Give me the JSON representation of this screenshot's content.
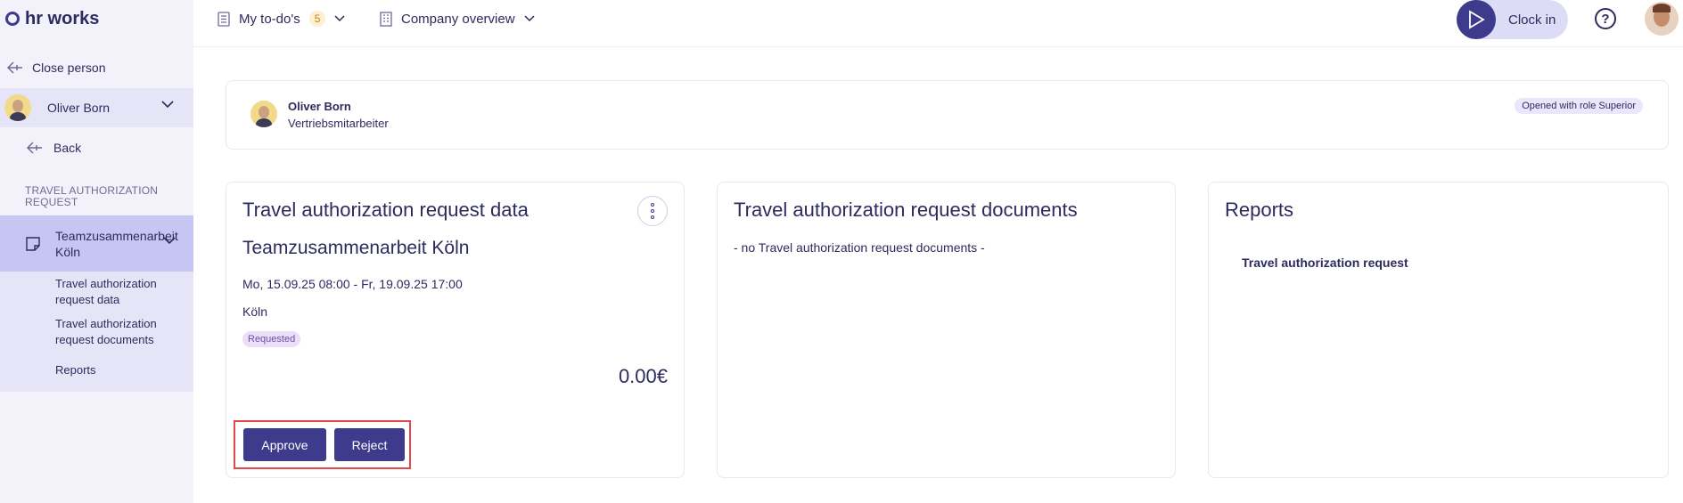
{
  "brand": {
    "name": "hr works"
  },
  "topbar": {
    "todos_label": "My to-do's",
    "todos_count": "5",
    "company_label": "Company overview",
    "clock_label": "Clock in",
    "help_glyph": "?"
  },
  "sidebar": {
    "close_person": "Close person",
    "person_name": "Oliver Born",
    "back": "Back",
    "section_label": "TRAVEL AUTHORIZATION REQUEST",
    "request_title": "Teamzusammenarbeit Köln",
    "sub_links": [
      "Travel authorization request data",
      "Travel authorization request documents",
      "Reports"
    ]
  },
  "person_card": {
    "name": "Oliver Born",
    "role": "Vertriebsmitarbeiter",
    "badge": "Opened with role Superior"
  },
  "data_card": {
    "title": "Travel authorization request data",
    "trip_name": "Teamzusammenarbeit Köln",
    "dates": "Mo, 15.09.25 08:00 - Fr, 19.09.25 17:00",
    "city": "Köln",
    "status": "Requested",
    "amount": "0.00€",
    "approve": "Approve",
    "reject": "Reject"
  },
  "docs_card": {
    "title": "Travel authorization request documents",
    "empty": "- no Travel authorization request documents -"
  },
  "reports_card": {
    "title": "Reports",
    "link": "Travel authorization request"
  },
  "icons": [
    "logo-icon",
    "checklist-icon",
    "chevron-down-icon",
    "building-icon",
    "play-icon",
    "help-icon",
    "arrow-left-icon",
    "note-icon",
    "more-vertical-icon"
  ],
  "colors": {
    "accent": "#3f3b8c",
    "highlight": "#e0484a",
    "sidebar_active": "#c7c6f2"
  }
}
